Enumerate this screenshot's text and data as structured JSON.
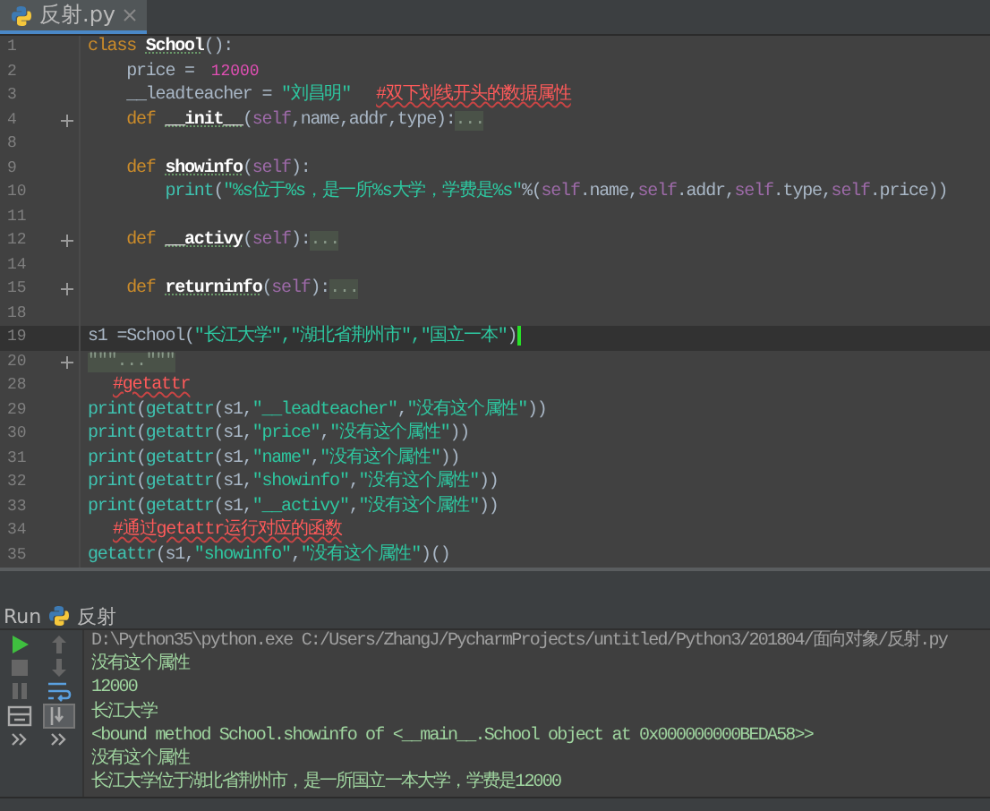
{
  "tab": {
    "title": "反射.py",
    "selected": true
  },
  "editor": {
    "lines": [
      {
        "number": "1",
        "fold": false,
        "current": false,
        "tokens": [
          {
            "kind": "kw",
            "text": "class "
          },
          {
            "kind": "name",
            "text": "School"
          },
          {
            "kind": "plain",
            "text": "():"
          }
        ]
      },
      {
        "number": "2",
        "fold": false,
        "current": false,
        "tokens": [
          {
            "kind": "plain",
            "text": "    price = "
          },
          {
            "kind": "num",
            "text": "12000"
          }
        ]
      },
      {
        "number": "3",
        "fold": false,
        "current": false,
        "tokens": [
          {
            "kind": "plain",
            "text": "    __leadteacher = "
          },
          {
            "kind": "str",
            "text": "\"刘昌明\""
          },
          {
            "kind": "comment",
            "text": "#双下划线开头的数据属性"
          }
        ]
      },
      {
        "number": "4",
        "fold": true,
        "current": false,
        "tokens": [
          {
            "kind": "kw",
            "text": "    def "
          },
          {
            "kind": "name",
            "text": "__init__"
          },
          {
            "kind": "plain",
            "text": "("
          },
          {
            "kind": "self",
            "text": "self"
          },
          {
            "kind": "plain",
            "text": ",name,addr,type):"
          },
          {
            "kind": "folded",
            "text": "..."
          }
        ]
      },
      {
        "number": "8",
        "fold": false,
        "current": false
      },
      {
        "number": "9",
        "fold": false,
        "current": false,
        "tokens": [
          {
            "kind": "kw",
            "text": "    def "
          },
          {
            "kind": "name",
            "text": "showinfo"
          },
          {
            "kind": "plain",
            "text": "("
          },
          {
            "kind": "self",
            "text": "self"
          },
          {
            "kind": "plain",
            "text": "):"
          }
        ]
      },
      {
        "number": "10",
        "fold": false,
        "current": false,
        "tokens": [
          {
            "kind": "builtin",
            "text": "        print"
          },
          {
            "kind": "plain",
            "text": "("
          },
          {
            "kind": "str",
            "text": "\"%s位于%s，是一所%s大学，学费是%s\""
          },
          {
            "kind": "plain",
            "text": "%("
          },
          {
            "kind": "self",
            "text": "self"
          },
          {
            "kind": "plain",
            "text": ".name,"
          },
          {
            "kind": "self",
            "text": "self"
          },
          {
            "kind": "plain",
            "text": ".addr,"
          },
          {
            "kind": "self",
            "text": "self"
          },
          {
            "kind": "plain",
            "text": ".type,"
          },
          {
            "kind": "self",
            "text": "self"
          },
          {
            "kind": "plain",
            "text": ".price))"
          }
        ]
      },
      {
        "number": "11",
        "fold": false,
        "current": false
      },
      {
        "number": "12",
        "fold": true,
        "current": false,
        "tokens": [
          {
            "kind": "kw",
            "text": "    def "
          },
          {
            "kind": "name",
            "text": "__activy"
          },
          {
            "kind": "plain",
            "text": "("
          },
          {
            "kind": "self",
            "text": "self"
          },
          {
            "kind": "plain",
            "text": "):"
          },
          {
            "kind": "folded",
            "text": "..."
          }
        ]
      },
      {
        "number": "14",
        "fold": false,
        "current": false
      },
      {
        "number": "15",
        "fold": true,
        "current": false,
        "tokens": [
          {
            "kind": "kw",
            "text": "    def "
          },
          {
            "kind": "name",
            "text": "returninfo"
          },
          {
            "kind": "plain",
            "text": "("
          },
          {
            "kind": "self",
            "text": "self"
          },
          {
            "kind": "plain",
            "text": "):"
          },
          {
            "kind": "folded",
            "text": "..."
          }
        ]
      },
      {
        "number": "18",
        "fold": false,
        "current": false
      },
      {
        "number": "19",
        "fold": false,
        "current": true,
        "tokens": [
          {
            "kind": "plain",
            "text": "s1 =School("
          },
          {
            "kind": "str",
            "text": "\"长江大学\",\"湖北省荆州市\",\"国立一本\""
          },
          {
            "kind": "plain",
            "text": ")"
          }
        ]
      },
      {
        "number": "20",
        "fold": true,
        "current": false,
        "tokens": [
          {
            "kind": "folded",
            "text": "\"\"\"...\"\"\""
          }
        ]
      },
      {
        "number": "28",
        "fold": false,
        "current": false,
        "tokens": [
          {
            "kind": "comment",
            "text": "#getattr"
          }
        ]
      },
      {
        "number": "29",
        "fold": false,
        "current": false,
        "tokens": [
          {
            "kind": "builtin",
            "text": "print"
          },
          {
            "kind": "plain",
            "text": "("
          },
          {
            "kind": "builtin",
            "text": "getattr"
          },
          {
            "kind": "plain",
            "text": "(s1,"
          },
          {
            "kind": "str",
            "text": "\"__leadteacher\""
          },
          {
            "kind": "plain",
            "text": ","
          },
          {
            "kind": "str",
            "text": "\"没有这个属性\""
          },
          {
            "kind": "plain",
            "text": "))"
          }
        ]
      },
      {
        "number": "30",
        "fold": false,
        "current": false,
        "tokens": [
          {
            "kind": "builtin",
            "text": "print"
          },
          {
            "kind": "plain",
            "text": "("
          },
          {
            "kind": "builtin",
            "text": "getattr"
          },
          {
            "kind": "plain",
            "text": "(s1,"
          },
          {
            "kind": "str",
            "text": "\"price\""
          },
          {
            "kind": "plain",
            "text": ","
          },
          {
            "kind": "str",
            "text": "\"没有这个属性\""
          },
          {
            "kind": "plain",
            "text": "))"
          }
        ]
      },
      {
        "number": "31",
        "fold": false,
        "current": false,
        "tokens": [
          {
            "kind": "builtin",
            "text": "print"
          },
          {
            "kind": "plain",
            "text": "("
          },
          {
            "kind": "builtin",
            "text": "getattr"
          },
          {
            "kind": "plain",
            "text": "(s1,"
          },
          {
            "kind": "str",
            "text": "\"name\""
          },
          {
            "kind": "plain",
            "text": ","
          },
          {
            "kind": "str",
            "text": "\"没有这个属性\""
          },
          {
            "kind": "plain",
            "text": "))"
          }
        ]
      },
      {
        "number": "32",
        "fold": false,
        "current": false,
        "tokens": [
          {
            "kind": "builtin",
            "text": "print"
          },
          {
            "kind": "plain",
            "text": "("
          },
          {
            "kind": "builtin",
            "text": "getattr"
          },
          {
            "kind": "plain",
            "text": "(s1,"
          },
          {
            "kind": "str",
            "text": "\"showinfo\""
          },
          {
            "kind": "plain",
            "text": ","
          },
          {
            "kind": "str",
            "text": "\"没有这个属性\""
          },
          {
            "kind": "plain",
            "text": "))"
          }
        ]
      },
      {
        "number": "33",
        "fold": false,
        "current": false,
        "tokens": [
          {
            "kind": "builtin",
            "text": "print"
          },
          {
            "kind": "plain",
            "text": "("
          },
          {
            "kind": "builtin",
            "text": "getattr"
          },
          {
            "kind": "plain",
            "text": "(s1,"
          },
          {
            "kind": "str",
            "text": "\"__activy\""
          },
          {
            "kind": "plain",
            "text": ","
          },
          {
            "kind": "str",
            "text": "\"没有这个属性\""
          },
          {
            "kind": "plain",
            "text": "))"
          }
        ]
      },
      {
        "number": "34",
        "fold": false,
        "current": false,
        "tokens": [
          {
            "kind": "comment",
            "text": "#通过getattr运行对应的函数"
          }
        ]
      },
      {
        "number": "35",
        "fold": false,
        "current": false,
        "tokens": [
          {
            "kind": "builtin",
            "text": "getattr"
          },
          {
            "kind": "plain",
            "text": "(s1,"
          },
          {
            "kind": "str",
            "text": "\"showinfo\""
          },
          {
            "kind": "plain",
            "text": ","
          },
          {
            "kind": "str",
            "text": "\"没有这个属性\""
          },
          {
            "kind": "plain",
            "text": ")()"
          }
        ]
      }
    ]
  },
  "run_panel": {
    "label": "Run",
    "config": "反射",
    "tools": [
      {
        "kind": "run",
        "disabled": false,
        "selected": false
      },
      {
        "kind": "up",
        "disabled": true,
        "selected": false
      },
      {
        "kind": "stop",
        "disabled": true,
        "selected": false
      },
      {
        "kind": "down",
        "disabled": true,
        "selected": false
      },
      {
        "kind": "pause",
        "disabled": true,
        "selected": false
      },
      {
        "kind": "wrap",
        "disabled": false,
        "selected": false
      },
      {
        "kind": "layout",
        "disabled": false,
        "selected": false
      },
      {
        "kind": "scroll",
        "disabled": false,
        "selected": true
      },
      {
        "kind": "more",
        "disabled": false,
        "selected": false
      },
      {
        "kind": "more",
        "disabled": false,
        "selected": false
      }
    ],
    "output": [
      {
        "kind": "command",
        "text": "D:\\Python35\\python.exe C:/Users/ZhangJ/PycharmProjects/untitled/Python3/201804/面向对象/反射.py"
      },
      {
        "kind": "stdout",
        "text": "没有这个属性"
      },
      {
        "kind": "stdout",
        "text": "12000"
      },
      {
        "kind": "stdout",
        "text": "长江大学"
      },
      {
        "kind": "stdout",
        "text": "<bound method School.showinfo of <__main__.School object at 0x000000000BEDA58>>"
      },
      {
        "kind": "stdout",
        "text": "没有这个属性"
      },
      {
        "kind": "stdout",
        "text": "长江大学位于湖北省荆州市，是一所国立一本大学，学费是12000"
      }
    ]
  }
}
